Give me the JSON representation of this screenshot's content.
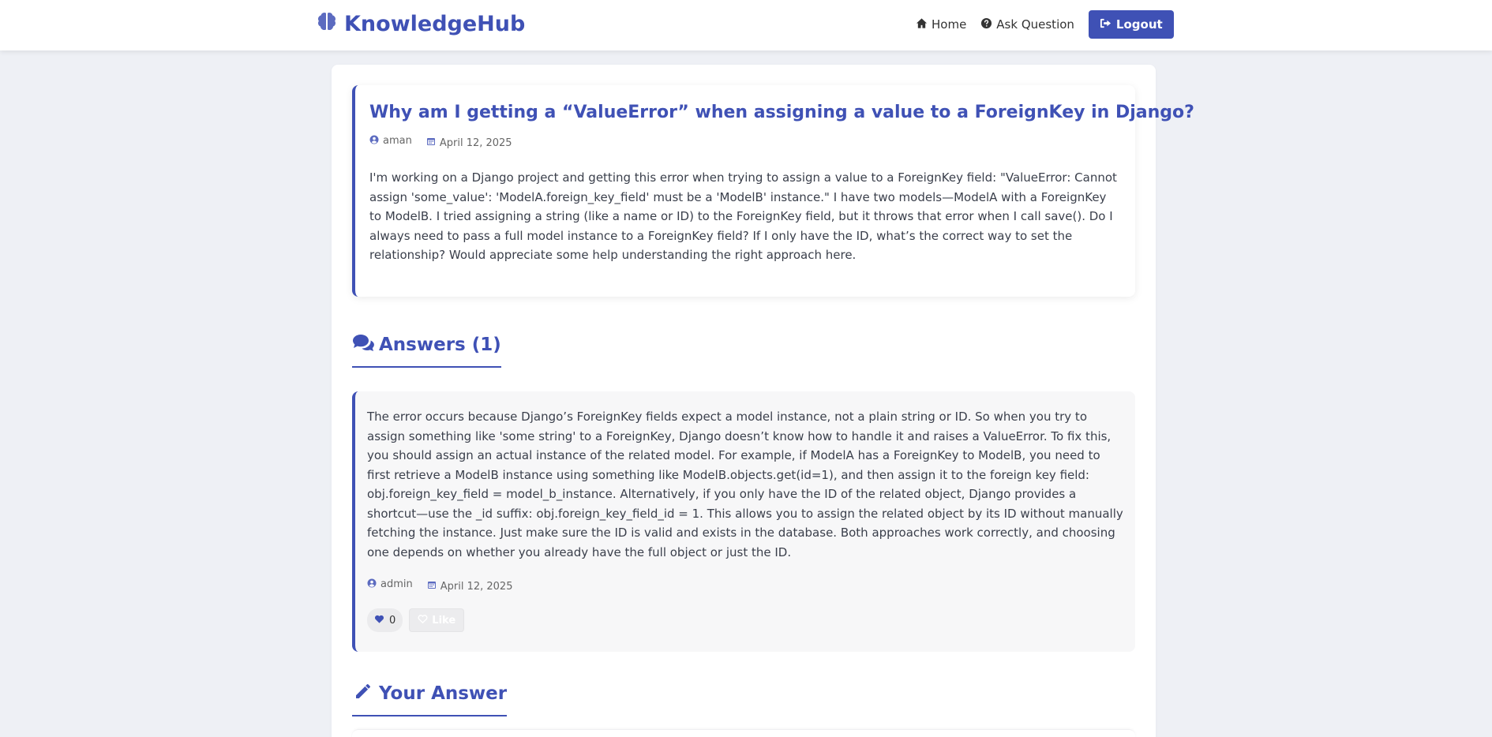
{
  "brand": {
    "name": "KnowledgeHub",
    "icon": "brain-icon",
    "color": "#3f51b5"
  },
  "nav": {
    "home": "Home",
    "ask": "Ask Question",
    "logout": "Logout"
  },
  "question": {
    "title": "Why am I getting a “ValueError” when assigning a value to a ForeignKey in Django?",
    "author": "aman",
    "date": "April 12, 2025",
    "body": "I'm working on a Django project and getting this error when trying to assign a value to a ForeignKey field: \"ValueError: Cannot assign 'some_value': 'ModelA.foreign_key_field' must be a 'ModelB' instance.\" I have two models—ModelA with a ForeignKey to ModelB. I tried assigning a string (like a name or ID) to the ForeignKey field, but it throws that error when I call save(). Do I always need to pass a full model instance to a ForeignKey field? If I only have the ID, what’s the correct way to set the relationship? Would appreciate some help understanding the right approach here."
  },
  "answers_section": {
    "label": "Answers (1)"
  },
  "answers": [
    {
      "body": "The error occurs because Django’s ForeignKey fields expect a model instance, not a plain string or ID. So when you try to assign something like 'some string' to a ForeignKey, Django doesn’t know how to handle it and raises a ValueError. To fix this, you should assign an actual instance of the related model. For example, if ModelA has a ForeignKey to ModelB, you need to first retrieve a ModelB instance using something like ModelB.objects.get(id=1), and then assign it to the foreign key field: obj.foreign_key_field = model_b_instance. Alternatively, if you only have the ID of the related object, Django provides a shortcut—use the _id suffix: obj.foreign_key_field_id = 1. This allows you to assign the related object by its ID without manually fetching the instance. Just make sure the ID is valid and exists in the database. Both approaches work correctly, and choosing one depends on whether you already have the full object or just the ID.",
      "author": "admin",
      "date": "April 12, 2025",
      "likes": "0",
      "like_label": "Like"
    }
  ],
  "your_answer_section": {
    "label": "Your Answer"
  }
}
